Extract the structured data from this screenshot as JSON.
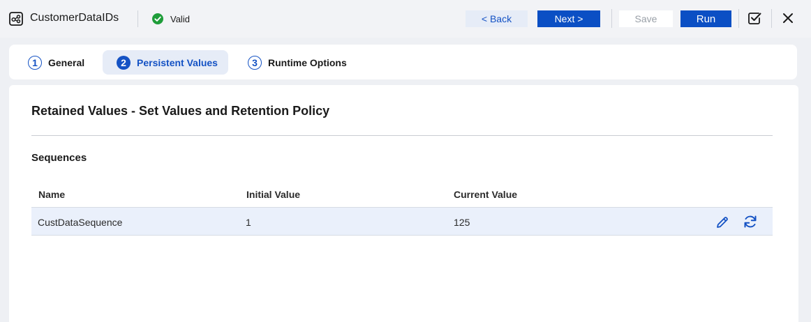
{
  "header": {
    "app_icon": "workflow-icon",
    "title": "CustomerDataIDs",
    "status": {
      "icon": "check-circle-icon",
      "label": "Valid",
      "color": "#1f9d3a"
    },
    "buttons": {
      "back": "< Back",
      "next": "Next >",
      "save": "Save",
      "run": "Run"
    },
    "icons": {
      "validate": "checkbox-check-icon",
      "close": "close-icon"
    },
    "accent_color": "#0b4fc4"
  },
  "tabs": [
    {
      "number": "1",
      "label": "General",
      "active": false
    },
    {
      "number": "2",
      "label": "Persistent Values",
      "active": true
    },
    {
      "number": "3",
      "label": "Runtime Options",
      "active": false
    }
  ],
  "main": {
    "section_title": "Retained Values - Set Values and Retention Policy",
    "sequences": {
      "title": "Sequences",
      "columns": [
        "Name",
        "Initial Value",
        "Current Value"
      ],
      "rows": [
        {
          "name": "CustDataSequence",
          "initial": "1",
          "current": "125",
          "actions": [
            "pencil-icon",
            "refresh-icon"
          ]
        }
      ]
    }
  }
}
